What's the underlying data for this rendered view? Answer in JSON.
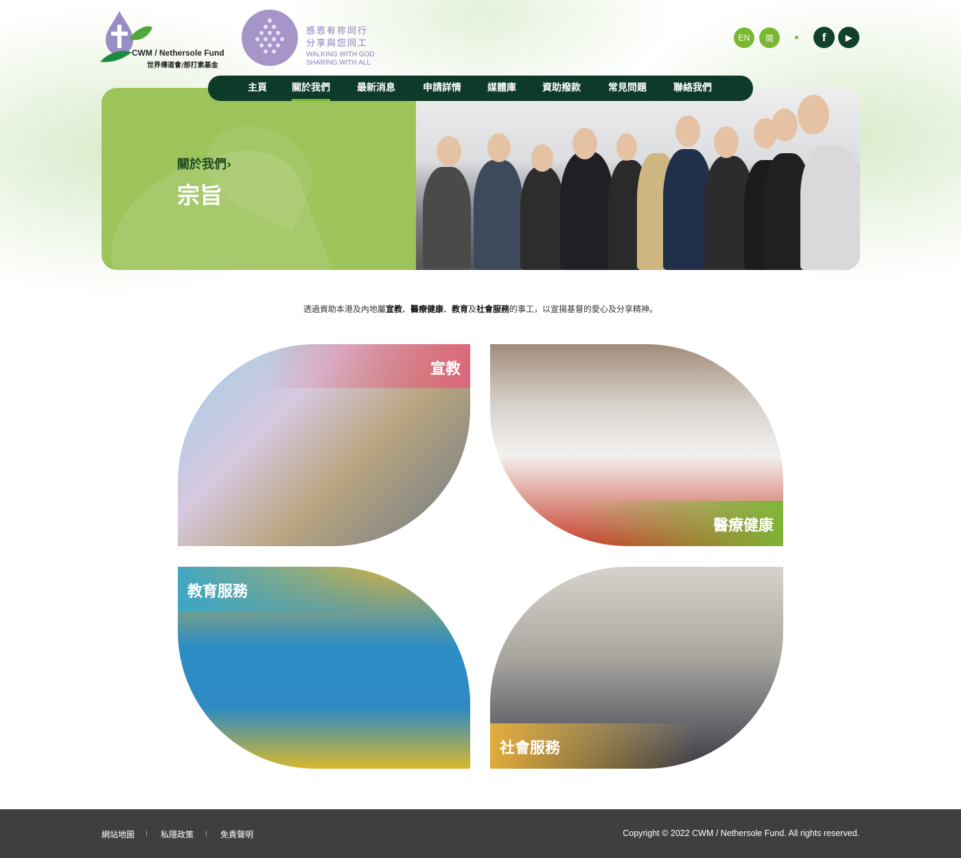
{
  "header": {
    "logo_fund": {
      "english": "CWM / Nethersole Fund",
      "chinese": "世界傳道會/那打素基金"
    },
    "logo_campaign": {
      "line1": "感恩有祢同行",
      "line2": "分享與您同工",
      "line3": "WALKING WITH GOD",
      "line4": "SHARING WITH ALL"
    },
    "lang": {
      "en": "EN",
      "sc": "简"
    },
    "social": {
      "facebook": "f",
      "youtube": "▶"
    }
  },
  "nav": {
    "items": [
      "主頁",
      "關於我們",
      "最新消息",
      "申請詳情",
      "媒體庫",
      "資助撥款",
      "常見問題",
      "聯絡我們"
    ],
    "active_index": 1
  },
  "hero": {
    "breadcrumb": "關於我們",
    "title": "宗旨"
  },
  "mission": {
    "prefix": "透過資助本港及內地屬",
    "item1": "宣教",
    "sep1": "、",
    "item2": "醫療健康",
    "sep2": "、",
    "item3": "教育",
    "mid": "及",
    "item4": "社會服務",
    "suffix": "的事工，以宣揚基督的愛心及分享精神。"
  },
  "cards": [
    {
      "label": "宣教",
      "color": "#e0627a"
    },
    {
      "label": "醫療健康",
      "color": "#7ab833"
    },
    {
      "label": "教育服務",
      "color": "#3aa6c8"
    },
    {
      "label": "社會服務",
      "color": "#e9b13a"
    }
  ],
  "footer": {
    "links": [
      "網站地圖",
      "私隱政策",
      "免責聲明"
    ],
    "copyright": "Copyright © 2022 CWM / Nethersole Fund. All rights reserved."
  }
}
